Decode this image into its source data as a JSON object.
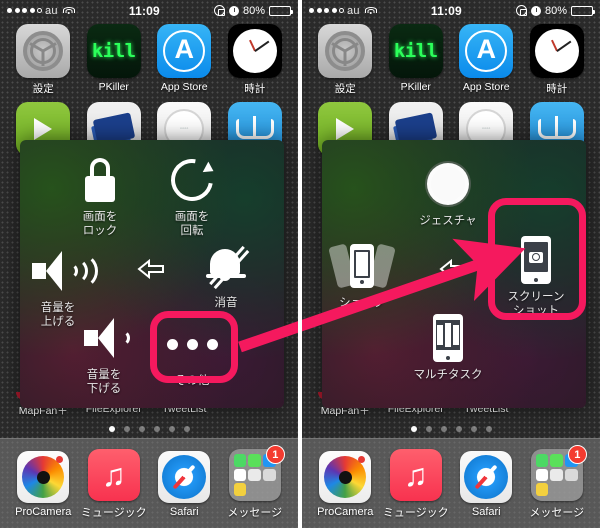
{
  "status_bar": {
    "signal_dots_filled": 4,
    "signal_dots_total": 5,
    "carrier": "au",
    "wifi_icon": "wifi-icon",
    "time": "11:09",
    "rotation_lock_icon": "rotation-lock-icon",
    "alarm_icon": "alarm-clock-icon",
    "battery_percent": "80%",
    "battery_level": 80
  },
  "home_screen": {
    "row1": [
      {
        "label": "設定",
        "icon": "settings-gear-icon"
      },
      {
        "label": "PKiller",
        "icon": "kill-text-icon",
        "icon_text": "kill"
      },
      {
        "label": "App Store",
        "icon": "app-store-icon",
        "icon_text": "A"
      },
      {
        "label": "時計",
        "icon": "clock-icon"
      }
    ],
    "row2": [
      {
        "label": "",
        "icon": "green-play-icon"
      },
      {
        "label": "",
        "icon": "blue-card-icon"
      },
      {
        "label": "",
        "icon": "white-dial-icon"
      },
      {
        "label": "",
        "icon": "ibooks-icon"
      }
    ],
    "row3": [
      {
        "label": "MapFan＋",
        "color": "#b01a2e"
      },
      {
        "label": "FileExplorer",
        "color": "#1a74c8"
      },
      {
        "label": "TweetList",
        "color": "#2196e0"
      },
      {
        "label": "",
        "color": "#3a3a3a"
      }
    ],
    "page_dots": 6,
    "active_page": 1
  },
  "dock": [
    {
      "label": "ProCamera",
      "icon": "procamera-icon",
      "badge": null
    },
    {
      "label": "ミュージック",
      "icon": "music-note-icon",
      "badge": null
    },
    {
      "label": "Safari",
      "icon": "safari-compass-icon",
      "badge": null
    },
    {
      "label": "メッセージ",
      "icon": "messages-folder-icon",
      "badge": "1"
    }
  ],
  "left_panel": {
    "panel_name": "assistive-touch-menu-main",
    "items": [
      {
        "id": "lock-screen",
        "label": "画面を\nロック",
        "label_lines": [
          "画面を",
          "ロック"
        ],
        "icon": "lock-icon"
      },
      {
        "id": "rotate-screen",
        "label": "画面を\n回転",
        "label_lines": [
          "画面を",
          "回転"
        ],
        "icon": "rotate-icon"
      },
      {
        "id": "volume-up",
        "label": "音量を\n上げる",
        "label_lines": [
          "音量を",
          "上げる"
        ],
        "icon": "volume-up-icon"
      },
      {
        "id": "mute",
        "label": "消音",
        "label_lines": [
          "消音"
        ],
        "icon": "bell-mute-icon"
      },
      {
        "id": "volume-down",
        "label": "音量を\n下げる",
        "label_lines": [
          "音量を",
          "下げる"
        ],
        "icon": "volume-down-icon"
      },
      {
        "id": "more",
        "label": "その他",
        "label_lines": [
          "その他"
        ],
        "icon": "three-dots-icon",
        "highlighted": true
      }
    ],
    "back_arrow_icon": "back-arrow-icon"
  },
  "right_panel": {
    "panel_name": "assistive-touch-menu-more",
    "items": [
      {
        "id": "gesture",
        "label": "ジェスチャ",
        "label_lines": [
          "ジェスチャ"
        ],
        "icon": "gesture-circle-icon"
      },
      {
        "id": "shake",
        "label": "シェイク",
        "label_lines": [
          "シェイク"
        ],
        "icon": "shake-device-icon"
      },
      {
        "id": "screenshot",
        "label": "スクリーン\nショット",
        "label_lines": [
          "スクリーン",
          "ショット"
        ],
        "icon": "screenshot-icon",
        "highlighted": true
      },
      {
        "id": "multitask",
        "label": "マルチタスク",
        "label_lines": [
          "マルチタスク"
        ],
        "icon": "multitask-icon"
      }
    ],
    "back_arrow_icon": "back-arrow-icon"
  },
  "annotations": {
    "highlight_color": "#f5195e",
    "arrow_from": "その他",
    "arrow_to": "スクリーンショット"
  }
}
